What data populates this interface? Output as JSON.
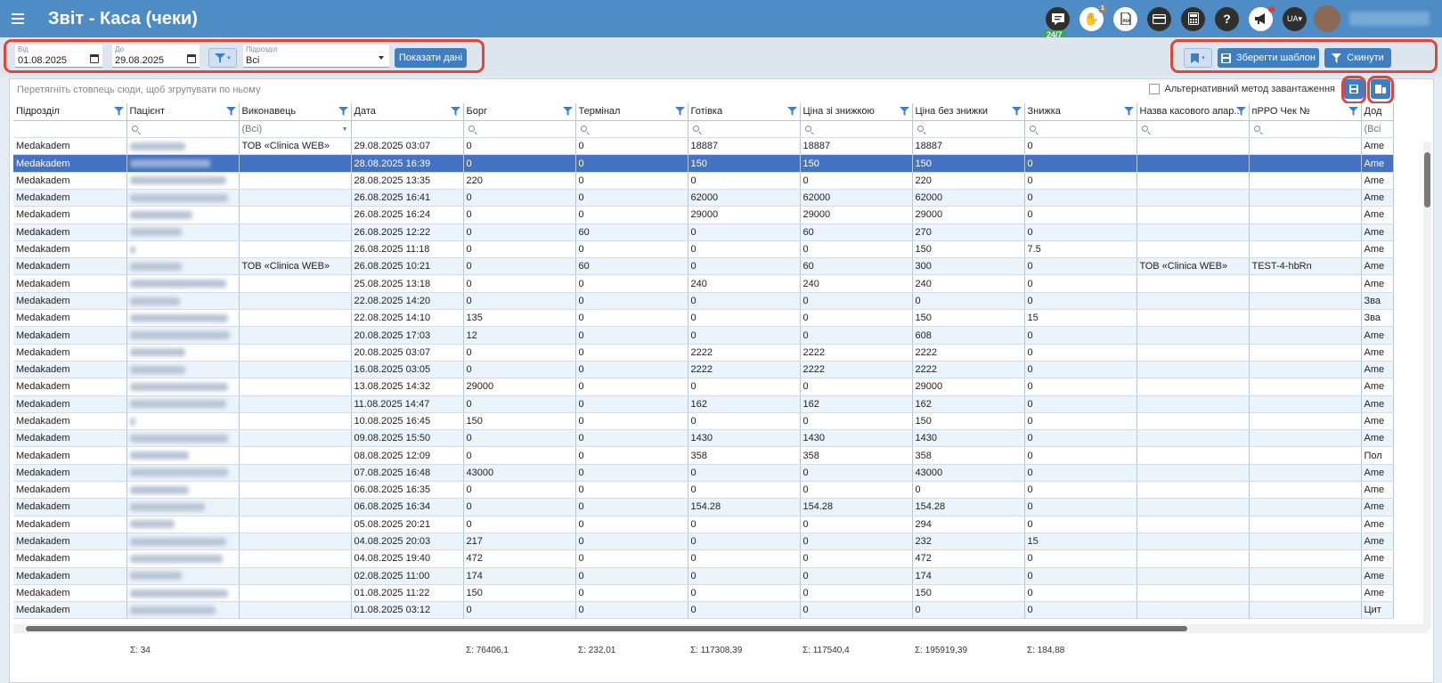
{
  "header": {
    "title": "Звіт - Каса (чеки)",
    "chat_badge": "24/7",
    "lang": "UA",
    "notif_count": "1",
    "icons": [
      "chat-icon",
      "hand-icon",
      "pdf-icon",
      "card-icon",
      "calculator-icon",
      "help-icon",
      "megaphone-icon"
    ]
  },
  "filters": {
    "from_label": "Від",
    "from_value": "01.08.2025",
    "to_label": "До",
    "to_value": "29.08.2025",
    "unit_label": "Підрозділ",
    "unit_value": "Всі",
    "show_button": "Показати дані",
    "save_template": "Зберегти шаблон",
    "reset": "Скинути"
  },
  "grid": {
    "group_hint": "Перетягніть стовпець сюди, щоб згрупувати по ньому",
    "alt_load": "Альтернативний метод завантаження",
    "columns": [
      "Підрозділ",
      "Пацієнт",
      "Виконавець",
      "Дата",
      "Борг",
      "Термінал",
      "Готівка",
      "Ціна зі знижкою",
      "Ціна без знижки",
      "Знижка",
      "Назва касового апар...",
      "пРРО Чек №",
      "Дод"
    ],
    "performer_filter": "(Всі)",
    "last_filter": "(Всі",
    "rows": [
      {
        "unit": "Medakadem",
        "performer": "ТОВ «Clinica WEB»",
        "date": "29.08.2025 03:07",
        "debt": "0",
        "terminal": "0",
        "cash": "18887",
        "disc_price": "18887",
        "price": "18887",
        "discount": "0",
        "kasa": "",
        "prro": "",
        "extra": "Ame",
        "pw": 62
      },
      {
        "unit": "Medakadem",
        "performer": "",
        "date": "28.08.2025 16:39",
        "debt": "0",
        "terminal": "0",
        "cash": "150",
        "disc_price": "150",
        "price": "150",
        "discount": "0",
        "kasa": "",
        "prro": "",
        "extra": "Ame",
        "pw": 90
      },
      {
        "unit": "Medakadem",
        "performer": "",
        "date": "28.08.2025 13:35",
        "debt": "220",
        "terminal": "0",
        "cash": "0",
        "disc_price": "0",
        "price": "220",
        "discount": "0",
        "kasa": "",
        "prro": "",
        "extra": "Ame",
        "pw": 108
      },
      {
        "unit": "Medakadem",
        "performer": "",
        "date": "26.08.2025 16:41",
        "debt": "0",
        "terminal": "0",
        "cash": "62000",
        "disc_price": "62000",
        "price": "62000",
        "discount": "0",
        "kasa": "",
        "prro": "",
        "extra": "Ame",
        "pw": 110
      },
      {
        "unit": "Medakadem",
        "performer": "",
        "date": "26.08.2025 16:24",
        "debt": "0",
        "terminal": "0",
        "cash": "29000",
        "disc_price": "29000",
        "price": "29000",
        "discount": "0",
        "kasa": "",
        "prro": "",
        "extra": "Ame",
        "pw": 70
      },
      {
        "unit": "Medakadem",
        "performer": "",
        "date": "26.08.2025 12:22",
        "debt": "0",
        "terminal": "60",
        "cash": "0",
        "disc_price": "60",
        "price": "270",
        "discount": "0",
        "kasa": "",
        "prro": "",
        "extra": "Ame",
        "pw": 58
      },
      {
        "unit": "Medakadem",
        "performer": "",
        "date": "26.08.2025 11:18",
        "debt": "0",
        "terminal": "0",
        "cash": "0",
        "disc_price": "0",
        "price": "150",
        "discount": "7.5",
        "kasa": "",
        "prro": "",
        "extra": "Ame",
        "pw": 6
      },
      {
        "unit": "Medakadem",
        "performer": "ТОВ «Clinica WEB»",
        "date": "26.08.2025 10:21",
        "debt": "0",
        "terminal": "60",
        "cash": "0",
        "disc_price": "60",
        "price": "300",
        "discount": "0",
        "kasa": "ТОВ «Clinica WEB»",
        "prro": "TEST-4-hbRn",
        "extra": "Ame",
        "pw": 58
      },
      {
        "unit": "Medakadem",
        "performer": "",
        "date": "25.08.2025 13:18",
        "debt": "0",
        "terminal": "0",
        "cash": "240",
        "disc_price": "240",
        "price": "240",
        "discount": "0",
        "kasa": "",
        "prro": "",
        "extra": "Ame",
        "pw": 108
      },
      {
        "unit": "Medakadem",
        "performer": "",
        "date": "22.08.2025 14:20",
        "debt": "0",
        "terminal": "0",
        "cash": "0",
        "disc_price": "0",
        "price": "0",
        "discount": "0",
        "kasa": "",
        "prro": "",
        "extra": "Зва",
        "pw": 56
      },
      {
        "unit": "Medakadem",
        "performer": "",
        "date": "22.08.2025 14:10",
        "debt": "135",
        "terminal": "0",
        "cash": "0",
        "disc_price": "0",
        "price": "150",
        "discount": "15",
        "kasa": "",
        "prro": "",
        "extra": "Зва",
        "pw": 110
      },
      {
        "unit": "Medakadem",
        "performer": "",
        "date": "20.08.2025 17:03",
        "debt": "12",
        "terminal": "0",
        "cash": "0",
        "disc_price": "0",
        "price": "608",
        "discount": "0",
        "kasa": "",
        "prro": "",
        "extra": "Ame",
        "pw": 112
      },
      {
        "unit": "Medakadem",
        "performer": "",
        "date": "20.08.2025 03:07",
        "debt": "0",
        "terminal": "0",
        "cash": "2222",
        "disc_price": "2222",
        "price": "2222",
        "discount": "0",
        "kasa": "",
        "prro": "",
        "extra": "Ame",
        "pw": 62
      },
      {
        "unit": "Medakadem",
        "performer": "",
        "date": "16.08.2025 03:05",
        "debt": "0",
        "terminal": "0",
        "cash": "2222",
        "disc_price": "2222",
        "price": "2222",
        "discount": "0",
        "kasa": "",
        "prro": "",
        "extra": "Ame",
        "pw": 62
      },
      {
        "unit": "Medakadem",
        "performer": "",
        "date": "13.08.2025 14:32",
        "debt": "29000",
        "terminal": "0",
        "cash": "0",
        "disc_price": "0",
        "price": "29000",
        "discount": "0",
        "kasa": "",
        "prro": "",
        "extra": "Ame",
        "pw": 110
      },
      {
        "unit": "Medakadem",
        "performer": "",
        "date": "11.08.2025 14:47",
        "debt": "0",
        "terminal": "0",
        "cash": "162",
        "disc_price": "162",
        "price": "162",
        "discount": "0",
        "kasa": "",
        "prro": "",
        "extra": "Ame",
        "pw": 108
      },
      {
        "unit": "Medakadem",
        "performer": "",
        "date": "10.08.2025 16:45",
        "debt": "150",
        "terminal": "0",
        "cash": "0",
        "disc_price": "0",
        "price": "150",
        "discount": "0",
        "kasa": "",
        "prro": "",
        "extra": "Ame",
        "pw": 6
      },
      {
        "unit": "Medakadem",
        "performer": "",
        "date": "09.08.2025 15:50",
        "debt": "0",
        "terminal": "0",
        "cash": "1430",
        "disc_price": "1430",
        "price": "1430",
        "discount": "0",
        "kasa": "",
        "prro": "",
        "extra": "Ame",
        "pw": 110
      },
      {
        "unit": "Medakadem",
        "performer": "",
        "date": "08.08.2025 12:09",
        "debt": "0",
        "terminal": "0",
        "cash": "358",
        "disc_price": "358",
        "price": "358",
        "discount": "0",
        "kasa": "",
        "prro": "",
        "extra": "Пол",
        "pw": 66
      },
      {
        "unit": "Medakadem",
        "performer": "",
        "date": "07.08.2025 16:48",
        "debt": "43000",
        "terminal": "0",
        "cash": "0",
        "disc_price": "0",
        "price": "43000",
        "discount": "0",
        "kasa": "",
        "prro": "",
        "extra": "Ame",
        "pw": 110
      },
      {
        "unit": "Medakadem",
        "performer": "",
        "date": "06.08.2025 16:35",
        "debt": "0",
        "terminal": "0",
        "cash": "0",
        "disc_price": "0",
        "price": "0",
        "discount": "0",
        "kasa": "",
        "prro": "",
        "extra": "Ame",
        "pw": 66
      },
      {
        "unit": "Medakadem",
        "performer": "",
        "date": "06.08.2025 16:34",
        "debt": "0",
        "terminal": "0",
        "cash": "154.28",
        "disc_price": "154.28",
        "price": "154.28",
        "discount": "0",
        "kasa": "",
        "prro": "",
        "extra": "Ame",
        "pw": 84
      },
      {
        "unit": "Medakadem",
        "performer": "",
        "date": "05.08.2025 20:21",
        "debt": "0",
        "terminal": "0",
        "cash": "0",
        "disc_price": "0",
        "price": "294",
        "discount": "0",
        "kasa": "",
        "prro": "",
        "extra": "Ame",
        "pw": 50
      },
      {
        "unit": "Medakadem",
        "performer": "",
        "date": "04.08.2025 20:03",
        "debt": "217",
        "terminal": "0",
        "cash": "0",
        "disc_price": "0",
        "price": "232",
        "discount": "15",
        "kasa": "",
        "prro": "",
        "extra": "Ame",
        "pw": 108
      },
      {
        "unit": "Medakadem",
        "performer": "",
        "date": "04.08.2025 19:40",
        "debt": "472",
        "terminal": "0",
        "cash": "0",
        "disc_price": "0",
        "price": "472",
        "discount": "0",
        "kasa": "",
        "prro": "",
        "extra": "Ame",
        "pw": 104
      },
      {
        "unit": "Medakadem",
        "performer": "",
        "date": "02.08.2025 11:00",
        "debt": "174",
        "terminal": "0",
        "cash": "0",
        "disc_price": "0",
        "price": "174",
        "discount": "0",
        "kasa": "",
        "prro": "",
        "extra": "Ame",
        "pw": 58
      },
      {
        "unit": "Medakadem",
        "performer": "",
        "date": "01.08.2025 11:22",
        "debt": "150",
        "terminal": "0",
        "cash": "0",
        "disc_price": "0",
        "price": "150",
        "discount": "0",
        "kasa": "",
        "prro": "",
        "extra": "Ame",
        "pw": 110
      },
      {
        "unit": "Medakadem",
        "performer": "",
        "date": "01.08.2025 03:12",
        "debt": "0",
        "terminal": "0",
        "cash": "0",
        "disc_price": "0",
        "price": "0",
        "discount": "0",
        "kasa": "",
        "prro": "",
        "extra": "Цит",
        "pw": 96
      }
    ],
    "totals": {
      "patient": "Σ: 34",
      "debt": "Σ: 76406,1",
      "terminal": "Σ: 232,01",
      "cash": "Σ: 117308,39",
      "disc_price": "Σ: 117540,4",
      "price": "Σ: 195919,39",
      "discount": "Σ: 184,88"
    },
    "selected_row": 1
  },
  "colors": {
    "header": "#4d8cc4",
    "accent": "#3f7ec0",
    "selected": "#4472c4",
    "highlight": "#e0453a"
  }
}
